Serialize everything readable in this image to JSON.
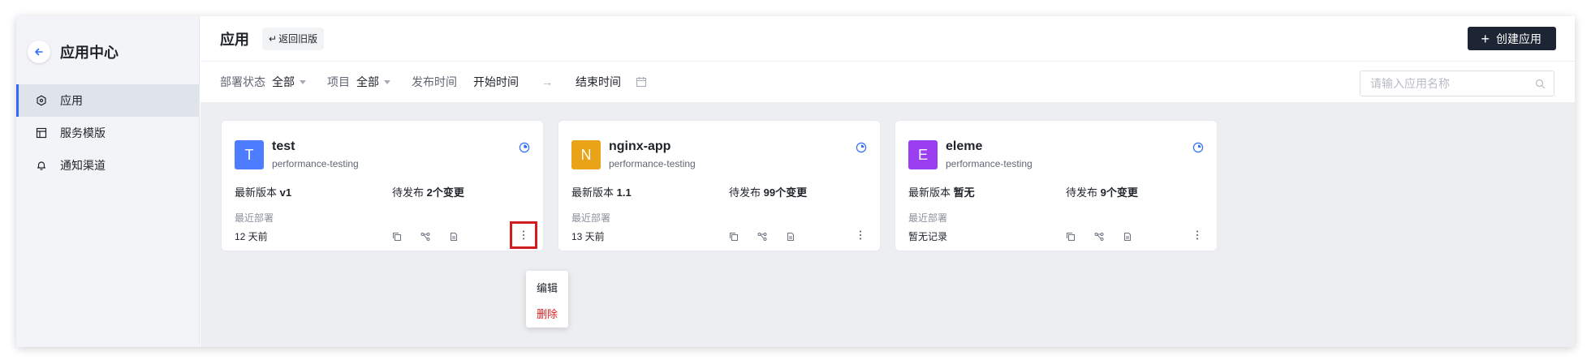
{
  "sidebar": {
    "title": "应用中心",
    "items": [
      {
        "label": "应用",
        "icon": "hexagon-icon",
        "active": true
      },
      {
        "label": "服务模版",
        "icon": "template-icon",
        "active": false
      },
      {
        "label": "通知渠道",
        "icon": "bell-icon",
        "active": false
      }
    ]
  },
  "header": {
    "title": "应用",
    "old_version_label": "返回旧版",
    "create_label": "创建应用"
  },
  "filters": {
    "deploy_status_label": "部署状态",
    "deploy_status_value": "全部",
    "project_label": "项目",
    "project_value": "全部",
    "publish_time_label": "发布时间",
    "start_placeholder": "开始时间",
    "end_placeholder": "结束时间",
    "search_placeholder": "请输入应用名称"
  },
  "labels": {
    "latest_version": "最新版本",
    "pending": "待发布",
    "recent_deploy": "最近部署"
  },
  "apps": [
    {
      "initial": "T",
      "color": "#4d7cfe",
      "name": "test",
      "project": "performance-testing",
      "version": "v1",
      "pending": "2个变更",
      "recent": "12 天前"
    },
    {
      "initial": "N",
      "color": "#e8a317",
      "name": "nginx-app",
      "project": "performance-testing",
      "version": "1.1",
      "pending": "99个变更",
      "recent": "13 天前"
    },
    {
      "initial": "E",
      "color": "#9b3df0",
      "name": "eleme",
      "project": "performance-testing",
      "version": "暂无",
      "pending": "9个变更",
      "recent": "暂无记录"
    }
  ],
  "context_menu": {
    "edit": "编辑",
    "delete": "删除"
  },
  "colors": {
    "accent": "#2f6bff",
    "danger": "#e02020",
    "dark_button": "#1d2433"
  }
}
